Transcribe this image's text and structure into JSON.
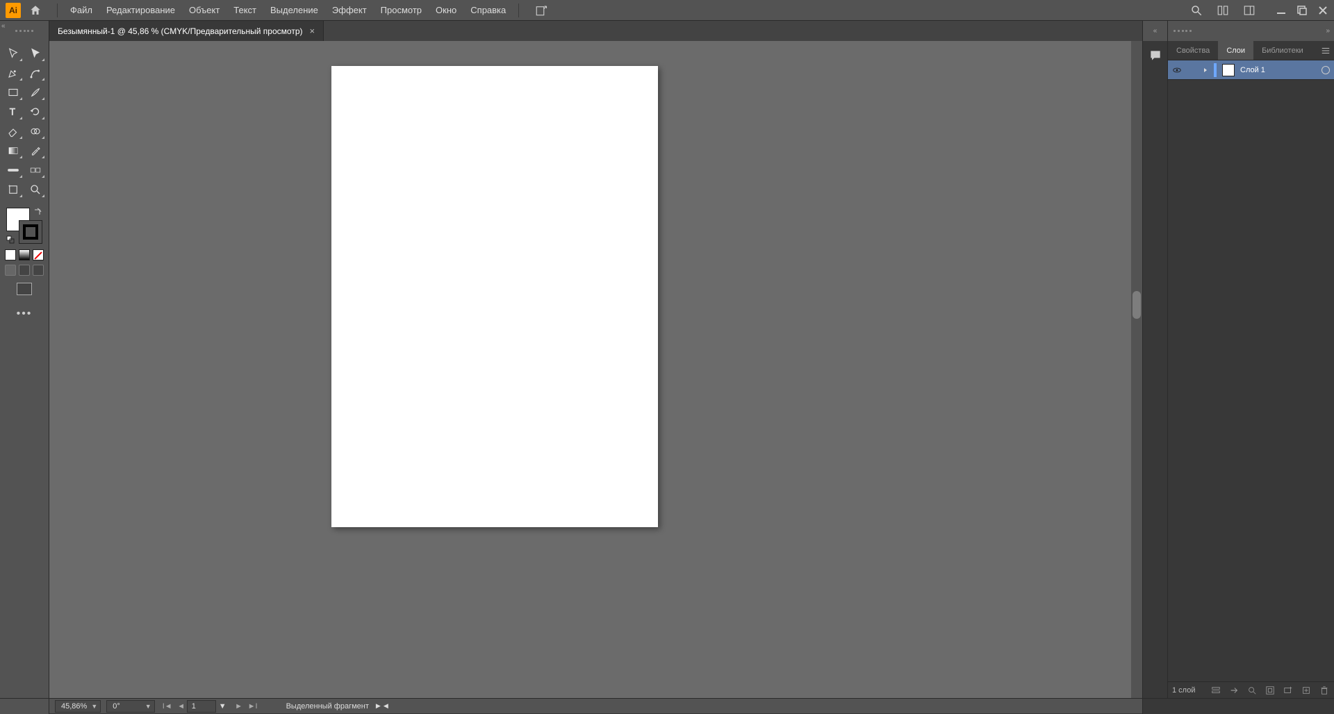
{
  "app_logo_text": "Ai",
  "menu": [
    "Файл",
    "Редактирование",
    "Объект",
    "Текст",
    "Выделение",
    "Эффект",
    "Просмотр",
    "Окно",
    "Справка"
  ],
  "doc_tab": "Безымянный-1 @ 45,86 % (CMYK/Предварительный просмотр)",
  "panel_tabs": [
    "Свойства",
    "Слои",
    "Библиотеки"
  ],
  "active_panel_tab": 1,
  "layer_name": "Слой 1",
  "layer_count_label": "1 слой",
  "status": {
    "zoom": "45,86%",
    "rotation": "0°",
    "page": "1",
    "selection_label": "Выделенный фрагмент"
  }
}
